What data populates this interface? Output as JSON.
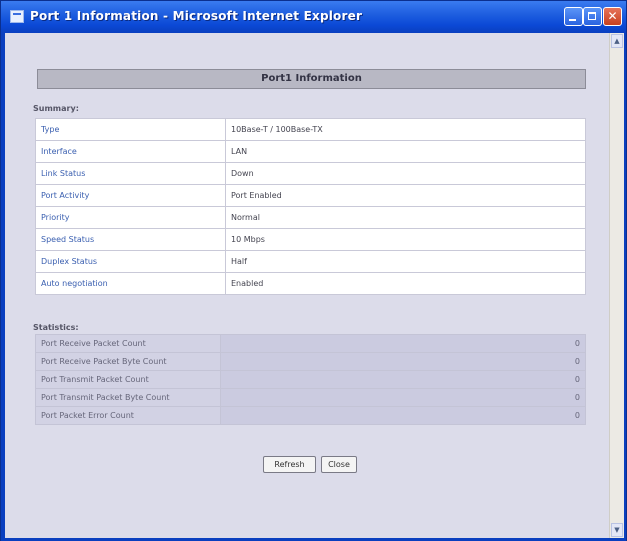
{
  "window": {
    "title": "Port 1 Information - Microsoft Internet Explorer"
  },
  "page": {
    "header": "Port1 Information",
    "summary_label": "Summary:",
    "summary_rows": [
      {
        "key": "Type",
        "value": "10Base-T / 100Base-TX"
      },
      {
        "key": "Interface",
        "value": "LAN"
      },
      {
        "key": "Link Status",
        "value": "Down"
      },
      {
        "key": "Port Activity",
        "value": "Port Enabled"
      },
      {
        "key": "Priority",
        "value": "Normal"
      },
      {
        "key": "Speed Status",
        "value": "10 Mbps"
      },
      {
        "key": "Duplex Status",
        "value": "Half"
      },
      {
        "key": "Auto negotiation",
        "value": "Enabled"
      }
    ],
    "statistics_label": "Statistics:",
    "stats_rows": [
      {
        "key": "Port Receive Packet Count",
        "value": "0"
      },
      {
        "key": "Port Receive Packet Byte Count",
        "value": "0"
      },
      {
        "key": "Port Transmit Packet Count",
        "value": "0"
      },
      {
        "key": "Port Transmit Packet Byte Count",
        "value": "0"
      },
      {
        "key": "Port Packet Error Count",
        "value": "0"
      }
    ],
    "buttons": {
      "refresh": "Refresh",
      "close": "Close"
    }
  },
  "icons": {
    "window_icon": "ie-page-icon",
    "minimize": "minimize-icon",
    "maximize": "maximize-icon",
    "close": "close-icon"
  },
  "colors": {
    "titlebar": "#0a3fbf",
    "client_bg": "#dcdcea",
    "header_bar": "#b8b8c4",
    "summary_key": "#3a5fb0"
  }
}
